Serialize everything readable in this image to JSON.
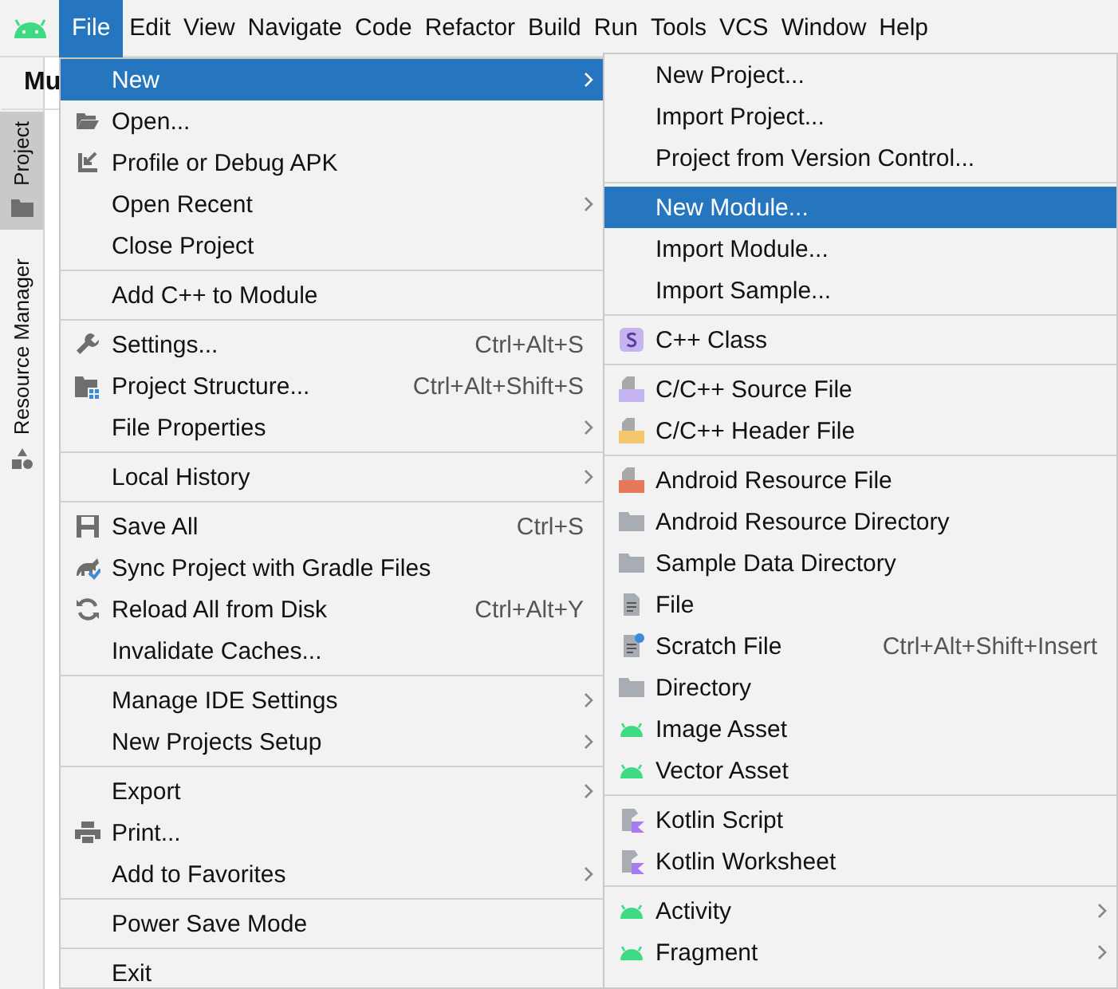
{
  "menubar": [
    {
      "label": "File",
      "selected": true
    },
    {
      "label": "Edit",
      "selected": false
    },
    {
      "label": "View",
      "selected": false
    },
    {
      "label": "Navigate",
      "selected": false
    },
    {
      "label": "Code",
      "selected": false
    },
    {
      "label": "Refactor",
      "selected": false
    },
    {
      "label": "Build",
      "selected": false
    },
    {
      "label": "Run",
      "selected": false
    },
    {
      "label": "Tools",
      "selected": false
    },
    {
      "label": "VCS",
      "selected": false
    },
    {
      "label": "Window",
      "selected": false
    },
    {
      "label": "Help",
      "selected": false
    }
  ],
  "toolbar": {
    "project_name": "Mu"
  },
  "side_tabs": [
    {
      "label": "Project",
      "kind": "folder",
      "selected": true
    },
    {
      "label": "Resource Manager",
      "kind": "shapes",
      "selected": false
    }
  ],
  "file_menu": {
    "sections": [
      [
        {
          "label": "New",
          "kind": "plain",
          "has_submenu": true,
          "selected": true
        },
        {
          "label": "Open...",
          "kind": "folder-open",
          "has_submenu": false,
          "selected": false
        },
        {
          "label": "Profile or Debug APK",
          "kind": "profile",
          "has_submenu": false,
          "selected": false
        },
        {
          "label": "Open Recent",
          "kind": "plain",
          "has_submenu": true,
          "selected": false
        },
        {
          "label": "Close Project",
          "kind": "plain",
          "has_submenu": false,
          "selected": false
        }
      ],
      [
        {
          "label": "Add C++ to Module",
          "kind": "plain",
          "has_submenu": false,
          "selected": false
        }
      ],
      [
        {
          "label": "Settings...",
          "kind": "wrench",
          "shortcut": "Ctrl+Alt+S",
          "has_submenu": false,
          "selected": false
        },
        {
          "label": "Project Structure...",
          "kind": "structure",
          "shortcut": "Ctrl+Alt+Shift+S",
          "has_submenu": false,
          "selected": false
        },
        {
          "label": "File Properties",
          "kind": "plain",
          "has_submenu": true,
          "selected": false
        }
      ],
      [
        {
          "label": "Local History",
          "kind": "plain",
          "has_submenu": true,
          "selected": false
        }
      ],
      [
        {
          "label": "Save All",
          "kind": "save",
          "shortcut": "Ctrl+S",
          "has_submenu": false,
          "selected": false
        },
        {
          "label": "Sync Project with Gradle Files",
          "kind": "sync",
          "has_submenu": false,
          "selected": false
        },
        {
          "label": "Reload All from Disk",
          "kind": "reload",
          "shortcut": "Ctrl+Alt+Y",
          "has_submenu": false,
          "selected": false
        },
        {
          "label": "Invalidate Caches...",
          "kind": "plain",
          "has_submenu": false,
          "selected": false
        }
      ],
      [
        {
          "label": "Manage IDE Settings",
          "kind": "plain",
          "has_submenu": true,
          "selected": false
        },
        {
          "label": "New Projects Setup",
          "kind": "plain",
          "has_submenu": true,
          "selected": false
        }
      ],
      [
        {
          "label": "Export",
          "kind": "plain",
          "has_submenu": true,
          "selected": false
        },
        {
          "label": "Print...",
          "kind": "print",
          "has_submenu": false,
          "selected": false
        },
        {
          "label": "Add to Favorites",
          "kind": "plain",
          "has_submenu": true,
          "selected": false
        }
      ],
      [
        {
          "label": "Power Save Mode",
          "kind": "plain",
          "has_submenu": false,
          "selected": false
        }
      ],
      [
        {
          "label": "Exit",
          "kind": "plain",
          "has_submenu": false,
          "selected": false
        }
      ]
    ]
  },
  "new_submenu": {
    "sections": [
      [
        {
          "label": "New Project...",
          "kind": "plain",
          "has_submenu": false,
          "selected": false
        },
        {
          "label": "Import Project...",
          "kind": "plain",
          "has_submenu": false,
          "selected": false
        },
        {
          "label": "Project from Version Control...",
          "kind": "plain",
          "has_submenu": false,
          "selected": false
        }
      ],
      [
        {
          "label": "New Module...",
          "kind": "plain",
          "has_submenu": false,
          "selected": true
        },
        {
          "label": "Import Module...",
          "kind": "plain",
          "has_submenu": false,
          "selected": false
        },
        {
          "label": "Import Sample...",
          "kind": "plain",
          "has_submenu": false,
          "selected": false
        }
      ],
      [
        {
          "label": "C++ Class",
          "kind": "cpp-class",
          "has_submenu": false,
          "selected": false
        }
      ],
      [
        {
          "label": "C/C++ Source File",
          "kind": "cpp-source",
          "has_submenu": false,
          "selected": false
        },
        {
          "label": "C/C++ Header File",
          "kind": "cpp-header",
          "has_submenu": false,
          "selected": false
        }
      ],
      [
        {
          "label": "Android Resource File",
          "kind": "resource-file",
          "has_submenu": false,
          "selected": false
        },
        {
          "label": "Android Resource Directory",
          "kind": "folder",
          "has_submenu": false,
          "selected": false
        },
        {
          "label": "Sample Data Directory",
          "kind": "folder",
          "has_submenu": false,
          "selected": false
        },
        {
          "label": "File",
          "kind": "file",
          "has_submenu": false,
          "selected": false
        },
        {
          "label": "Scratch File",
          "kind": "scratch",
          "shortcut": "Ctrl+Alt+Shift+Insert",
          "has_submenu": false,
          "selected": false
        },
        {
          "label": "Directory",
          "kind": "folder",
          "has_submenu": false,
          "selected": false
        },
        {
          "label": "Image Asset",
          "kind": "android",
          "has_submenu": false,
          "selected": false
        },
        {
          "label": "Vector Asset",
          "kind": "android",
          "has_submenu": false,
          "selected": false
        }
      ],
      [
        {
          "label": "Kotlin Script",
          "kind": "kotlin",
          "has_submenu": false,
          "selected": false
        },
        {
          "label": "Kotlin Worksheet",
          "kind": "kotlin",
          "has_submenu": false,
          "selected": false
        }
      ],
      [
        {
          "label": "Activity",
          "kind": "android",
          "has_submenu": true,
          "selected": false
        },
        {
          "label": "Fragment",
          "kind": "android",
          "has_submenu": true,
          "selected": false
        }
      ]
    ]
  }
}
